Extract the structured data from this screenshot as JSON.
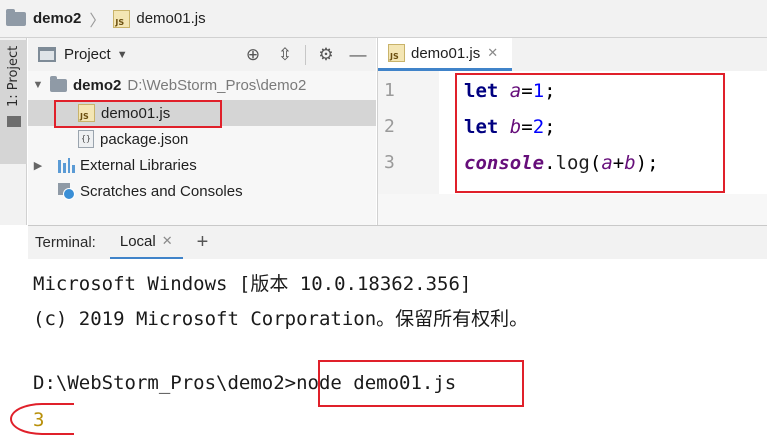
{
  "breadcrumb": {
    "project": "demo2",
    "file": "demo01.js"
  },
  "side_strip": {
    "label": "1: Project"
  },
  "project_panel": {
    "title": "Project",
    "tree": [
      {
        "label": "demo2",
        "path": "D:\\WebStorm_Pros\\demo2"
      },
      {
        "label": "demo01.js"
      },
      {
        "label": "package.json"
      },
      {
        "label": "External Libraries"
      },
      {
        "label": "Scratches and Consoles"
      }
    ]
  },
  "editor": {
    "tab": "demo01.js",
    "line_numbers": [
      "1",
      "2",
      "3"
    ],
    "code": [
      {
        "kw": "let",
        "var": "a",
        "op": "=",
        "num": "1",
        "end": ";"
      },
      {
        "kw": "let",
        "var": "b",
        "op": "=",
        "num": "2",
        "end": ";"
      },
      {
        "fn": "console",
        "dot": ".",
        "method": "log",
        "open": "(",
        "a": "a",
        "plus": "+",
        "b": "b",
        "close": ");"
      }
    ]
  },
  "terminal": {
    "label": "Terminal:",
    "tab": "Local",
    "lines": [
      "Microsoft Windows [版本 10.0.18362.356]",
      "(c) 2019 Microsoft Corporation。保留所有权利。",
      "D:\\WebStorm_Pros\\demo2>node demo01.js",
      "3"
    ]
  },
  "colors": {
    "annotation": "#e0202a",
    "keyword": "#000080",
    "variable": "#660e7a",
    "number": "#0000ff",
    "output": "#b8900a",
    "tab_accent": "#4083c9"
  },
  "icons": [
    "folder-icon",
    "js-file-icon",
    "json-file-icon",
    "library-icon",
    "scratches-icon",
    "locate-icon",
    "collapse-icon",
    "gear-icon",
    "chevron-down-icon",
    "close-icon",
    "plus-icon"
  ]
}
